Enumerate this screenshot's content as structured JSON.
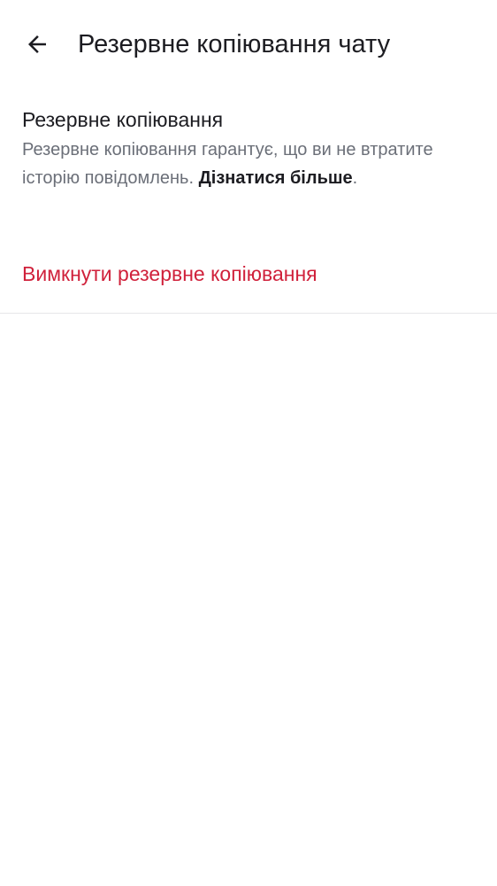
{
  "header": {
    "back_icon": "arrow-left-icon",
    "title": "Резервне копіювання чату"
  },
  "backup": {
    "title": "Резервне копіювання",
    "description": "Резервне копіювання гарантує, що ви не втратите історію повідомлень. ",
    "learn_more": "Дізнатися більше",
    "description_end": ".",
    "disable_label": "Вимкнути резервне копіювання"
  },
  "colors": {
    "background": "#ffffff",
    "title_text": "#1c1c21",
    "secondary_text": "#6b6f78",
    "destructive": "#d0213b",
    "divider": "#e6e6e9"
  }
}
